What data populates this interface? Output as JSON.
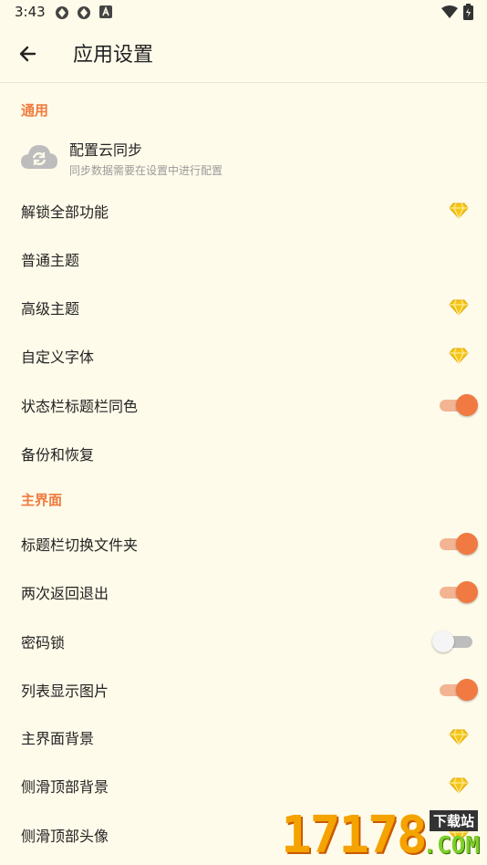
{
  "status_bar": {
    "time": "3:43"
  },
  "app_bar": {
    "title": "应用设置"
  },
  "sections": {
    "general": "通用",
    "main": "主界面"
  },
  "cloud_sync": {
    "title": "配置云同步",
    "subtitle": "同步数据需要在设置中进行配置"
  },
  "rows": {
    "unlock": "解锁全部功能",
    "normal_theme": "普通主题",
    "advanced_theme": "高级主题",
    "custom_font": "自定义字体",
    "statusbar_color": "状态栏标题栏同色",
    "backup": "备份和恢复",
    "title_switch_folder": "标题栏切换文件夹",
    "double_back_exit": "两次返回退出",
    "password_lock": "密码锁",
    "list_show_images": "列表显示图片",
    "main_bg": "主界面背景",
    "drawer_bg": "侧滑顶部背景",
    "drawer_avatar": "侧滑顶部头像"
  },
  "toggles": {
    "statusbar_color": true,
    "title_switch_folder": true,
    "double_back_exit": true,
    "password_lock": false,
    "list_show_images": true
  },
  "watermark": {
    "digits": "17178",
    "badge": "下载站",
    "domain": ".COM"
  },
  "colors": {
    "accent": "#ef7a3d",
    "background": "#fffbea",
    "premium_gem": "#f5c518"
  }
}
